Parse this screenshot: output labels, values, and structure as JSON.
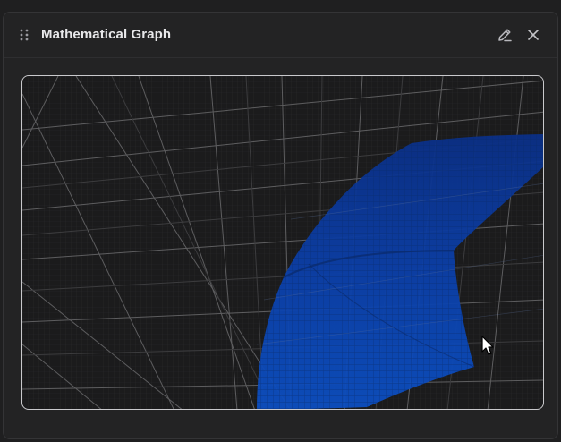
{
  "window": {
    "title": "Mathematical Graph"
  },
  "icons": {
    "drag": "drag-handle-icon",
    "edit": "pencil-icon",
    "close": "close-icon"
  },
  "colors": {
    "background": "#1f1f20",
    "panel": "#232324",
    "surface": "#1b1b1c",
    "surface_fill": "#0b3fa8",
    "grid": "#8a8a8a",
    "title_text": "#e8e8ea"
  }
}
